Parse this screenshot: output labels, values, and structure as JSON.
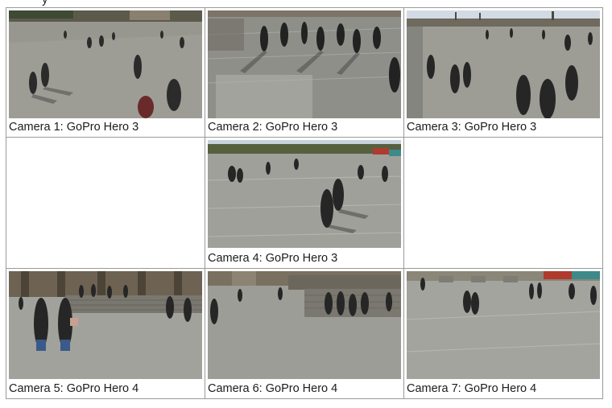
{
  "header_fragment": "y",
  "cameras": [
    {
      "caption": "Camera 1: GoPro Hero 3",
      "scene": "plaza crowd with many pedestrians, shadows on paved square, trees in background"
    },
    {
      "caption": "Camera 2: GoPro Hero 3",
      "scene": "elevated view of pedestrians walking across paved plaza with stairs"
    },
    {
      "caption": "Camera 3: GoPro Hero 3",
      "scene": "plaza with pedestrians and buildings on horizon under blue sky"
    },
    {
      "caption": "Camera 4: GoPro Hero 3",
      "scene": "wide plaza with pedestrians, person with backpack in center"
    },
    {
      "caption": "Camera 5: GoPro Hero 4",
      "scene": "building facade with stairs and crowd, two people in foreground"
    },
    {
      "caption": "Camera 6: GoPro Hero 4",
      "scene": "plaza with stairs and building, pedestrians in distance"
    },
    {
      "caption": "Camera 7: GoPro Hero 4",
      "scene": "open plaza with scattered pedestrians and benches"
    }
  ],
  "colors": {
    "border": "#9a9a9a",
    "pavement": "#9c9c96",
    "sky": "#cfd9e4",
    "building": "#7a6e5e",
    "grass": "#6a7a4e"
  }
}
